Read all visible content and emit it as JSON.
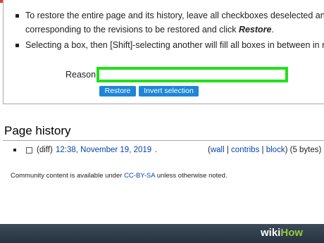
{
  "restore_box": {
    "bullets": [
      {
        "line1": "To restore the entire page and its history, leave all checkboxes deselected and c",
        "line2_prefix": "corresponding to the revisions to be restored and click ",
        "line2_emph": "Restore",
        "line2_suffix": "."
      },
      {
        "line1": "Selecting a box, then [Shift]-selecting another will fill all boxes in between in ma"
      }
    ],
    "reason_label": "Reason:",
    "reason_value": "",
    "restore_button": "Restore",
    "invert_button": "Invert selection"
  },
  "page_history": {
    "heading": "Page history",
    "rows": [
      {
        "diff": "(diff)",
        "date": "12:38, November 19, 2019",
        "sep": ".",
        "open_paren": "(",
        "wall": "wall",
        "bar1": " | ",
        "contribs": "contribs",
        "bar2": " | ",
        "block": "block",
        "close_paren": ")",
        "size": " (5 bytes)"
      }
    ]
  },
  "footer": {
    "prefix": "Community content is available under ",
    "license": "CC-BY-SA",
    "suffix": " unless otherwise noted."
  },
  "watermark": {
    "wiki": "wiki",
    "how": "How"
  }
}
